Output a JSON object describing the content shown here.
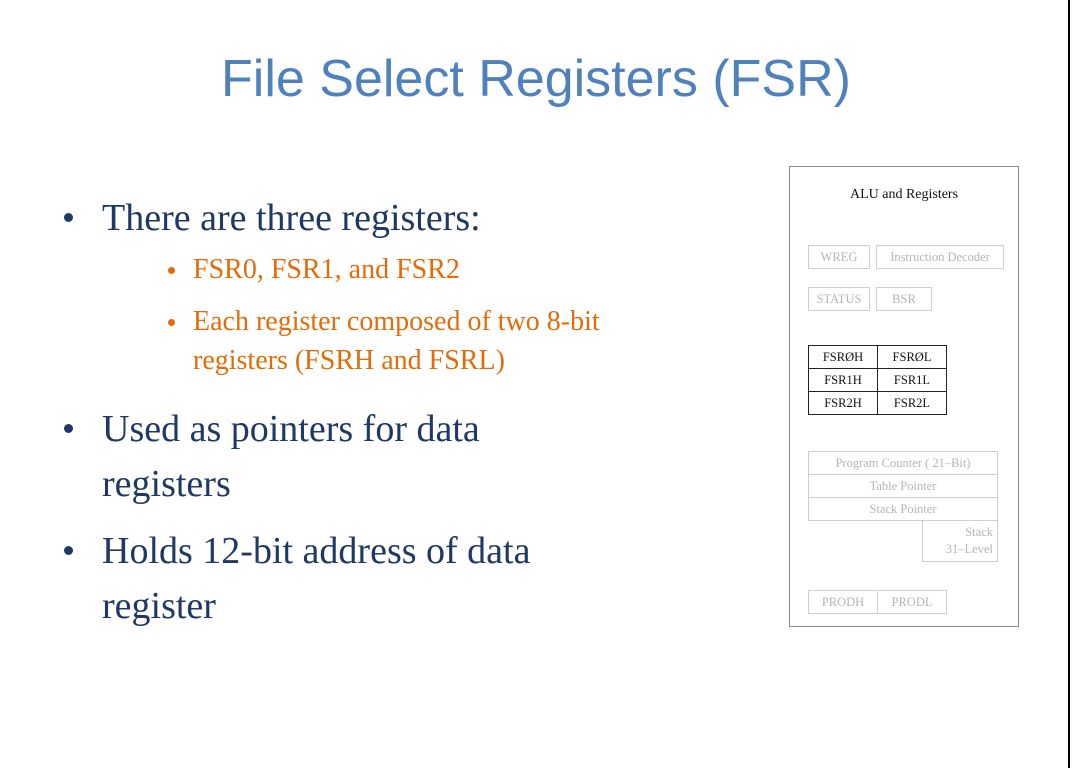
{
  "slide": {
    "title": "File Select Registers (FSR)",
    "bullets": [
      {
        "text": "There are three registers:",
        "level": 1
      },
      {
        "text": "FSR0, FSR1, and FSR2",
        "level": 2
      },
      {
        "text": "Each register composed of two 8-bit",
        "text_cont": "registers (FSRH and FSRL)",
        "level": 2
      },
      {
        "text": "Used as pointers for data",
        "text_cont": "registers",
        "level": 1
      },
      {
        "text": "Holds 12-bit address of data",
        "text_cont": "register",
        "level": 1
      }
    ],
    "colors": {
      "title": "#4F81BD",
      "level1": "#1F3864",
      "level2": "#E36C09"
    }
  },
  "diagram": {
    "title": "ALU and Registers",
    "wreg": "WREG",
    "instruction_decoder": "Instruction Decoder",
    "status": "STATUS",
    "bsr": "BSR",
    "fsr_rows": [
      {
        "high": "FSRØH",
        "low": "FSRØL"
      },
      {
        "high": "FSR1H",
        "low": "FSR1L"
      },
      {
        "high": "FSR2H",
        "low": "FSR2L"
      }
    ],
    "program_counter": "Program Counter ( 21–Bit)",
    "table_pointer": "Table Pointer",
    "stack_pointer": "Stack Pointer",
    "stack_line1": "Stack",
    "stack_line2": "31–Level",
    "prodh": "PRODH",
    "prodl": "PRODL"
  }
}
